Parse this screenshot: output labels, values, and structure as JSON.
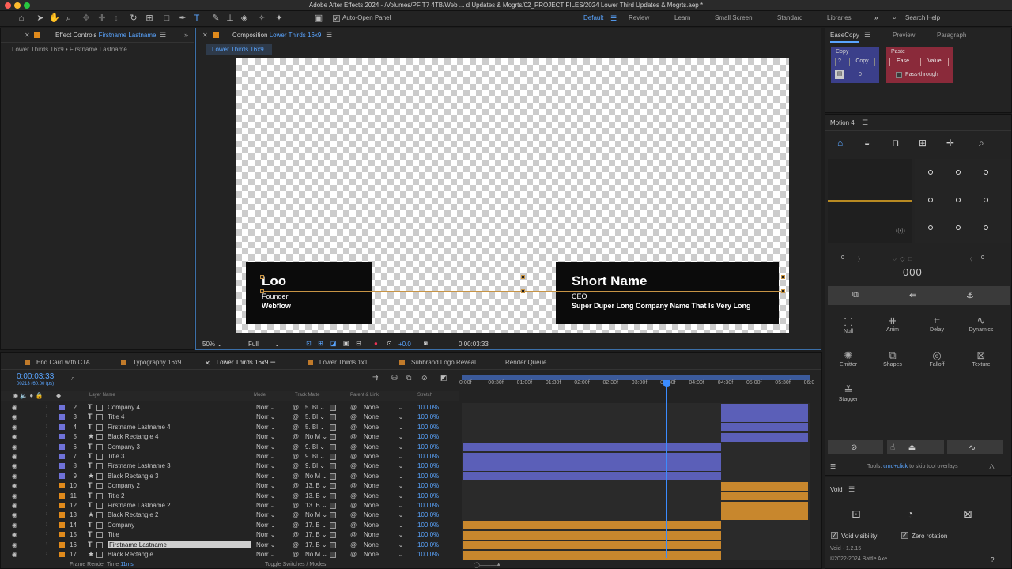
{
  "window": {
    "title": "Adobe After Effects 2024 - /Volumes/PF T7 4TB/Web ... d Updates & Mogrts/02_PROJECT FILES/2024 Lower Third Updates & Mogrts.aep *"
  },
  "toolbar": {
    "auto_open_label": "Auto-Open Panel",
    "search_label": "Search Help",
    "workspaces": [
      "Default",
      "Review",
      "Learn",
      "Small Screen",
      "Standard",
      "Libraries"
    ]
  },
  "effect_controls": {
    "tab_label": "Effect Controls",
    "tab_layer": "Firstname Lastname",
    "breadcrumb": "Lower Thirds 16x9 • Firstname Lastname"
  },
  "composition": {
    "tab_label": "Composition",
    "tab_comp": "Lower Thirds 16x9",
    "subtab": "Lower Thirds 16x9",
    "zoom": "50%",
    "quality": "Full",
    "exposure": "+0.0",
    "timecode": "0:00:03:33",
    "left_card": {
      "name": "Loo",
      "role": "Founder",
      "company": "Webflow"
    },
    "right_card": {
      "name": "Short Name",
      "role": "CEO",
      "company": "Super Duper Long Company Name That Is Very Long"
    }
  },
  "easecopy": {
    "tabs": [
      "EaseCopy",
      "Preview",
      "Paragraph"
    ],
    "copy_label": "Copy",
    "copy_button": "Copy",
    "q_button": "?",
    "count": "0",
    "paste_label": "Paste",
    "ease_button": "Ease",
    "value_button": "Value",
    "passthrough": "Pass-through"
  },
  "motion": {
    "title": "Motion 4",
    "left_value": "0",
    "right_value": "0",
    "center_value": "000",
    "tools": [
      {
        "label": "Null",
        "icon": "null-icon"
      },
      {
        "label": "Anim",
        "icon": "anim-icon"
      },
      {
        "label": "Delay",
        "icon": "delay-icon"
      },
      {
        "label": "Dynamics",
        "icon": "dynamics-icon"
      },
      {
        "label": "Emitter",
        "icon": "emitter-icon"
      },
      {
        "label": "Shapes",
        "icon": "shapes-icon"
      },
      {
        "label": "Falloff",
        "icon": "falloff-icon"
      },
      {
        "label": "Texture",
        "icon": "texture-icon"
      },
      {
        "label": "Stagger",
        "icon": "stagger-icon"
      }
    ],
    "tip_prefix": "Tools: ",
    "tip_key": "cmd+click",
    "tip_suffix": " to skip tool overlays"
  },
  "void": {
    "title": "Void",
    "void_visibility": "Void visibility",
    "zero_rotation": "Zero rotation",
    "version": "Void - 1.2.15",
    "copyright": "©2022-2024 Battle Axe"
  },
  "timeline": {
    "tabs": [
      {
        "label": "End Card with CTA",
        "color": "#c07a2a"
      },
      {
        "label": "Typography 16x9",
        "color": "#c07a2a"
      },
      {
        "label": "Lower Thirds 16x9",
        "color": "#c07a2a"
      },
      {
        "label": "Lower Thirds 1x1",
        "color": "#c07a2a"
      },
      {
        "label": "Subbrand Logo Reveal",
        "color": "#c07a2a"
      },
      {
        "label": "Render Queue",
        "color": ""
      }
    ],
    "timecode": "0:00:03:33",
    "fps": "00213 (60.00 fps)",
    "search_placeholder": "",
    "headers": {
      "layer_name": "Layer Name",
      "mode": "Mode",
      "track_matte": "Track Matte",
      "parent": "Parent & Link",
      "stretch": "Stretch"
    },
    "ruler": [
      "0:00f",
      "00:30f",
      "01:00f",
      "01:30f",
      "02:00f",
      "02:30f",
      "03:00f",
      "03:30f",
      "04:00f",
      "04:30f",
      "05:00f",
      "05:30f",
      "06:0"
    ],
    "footer_left": "Frame Render Time",
    "footer_ms": "11ms",
    "footer_toggle": "Toggle Switches / Modes",
    "layers": [
      {
        "num": "2",
        "type": "T",
        "name": "Company 4",
        "mode": "Norr",
        "matte": "5. Bl",
        "parent": "None",
        "stretch": "100.0%",
        "color": "#6f72d8",
        "bar": "purple",
        "start": 0.75
      },
      {
        "num": "3",
        "type": "T",
        "name": "Title 4",
        "mode": "Norr",
        "matte": "5. Bl",
        "parent": "None",
        "stretch": "100.0%",
        "color": "#6f72d8",
        "bar": "purple",
        "start": 0.75
      },
      {
        "num": "4",
        "type": "T",
        "name": "Firstname Lastname 4",
        "mode": "Norr",
        "matte": "5. Bl",
        "parent": "None",
        "stretch": "100.0%",
        "color": "#6f72d8",
        "bar": "purple",
        "start": 0.75
      },
      {
        "num": "5",
        "type": "★",
        "name": "Black Rectangle 4",
        "mode": "Norr",
        "matte": "No M",
        "parent": "None",
        "stretch": "100.0%",
        "color": "#6f72d8",
        "bar": "purple",
        "start": 0.75
      },
      {
        "num": "6",
        "type": "T",
        "name": "Company 3",
        "mode": "Norr",
        "matte": "9. Bl",
        "parent": "None",
        "stretch": "100.0%",
        "color": "#6f72d8",
        "bar": "purple",
        "start": 0
      },
      {
        "num": "7",
        "type": "T",
        "name": "Title 3",
        "mode": "Norr",
        "matte": "9. Bl",
        "parent": "None",
        "stretch": "100.0%",
        "color": "#6f72d8",
        "bar": "purple",
        "start": 0
      },
      {
        "num": "8",
        "type": "T",
        "name": "Firstname Lastname 3",
        "mode": "Norr",
        "matte": "9. Bl",
        "parent": "None",
        "stretch": "100.0%",
        "color": "#6f72d8",
        "bar": "purple",
        "start": 0
      },
      {
        "num": "9",
        "type": "★",
        "name": "Black Rectangle 3",
        "mode": "Norr",
        "matte": "No M",
        "parent": "None",
        "stretch": "100.0%",
        "color": "#6f72d8",
        "bar": "purple",
        "start": 0
      },
      {
        "num": "10",
        "type": "T",
        "name": "Company 2",
        "mode": "Norr",
        "matte": "13. B",
        "parent": "None",
        "stretch": "100.0%",
        "color": "#e08a1c",
        "bar": "orange",
        "start": 0.75
      },
      {
        "num": "11",
        "type": "T",
        "name": "Title 2",
        "mode": "Norr",
        "matte": "13. B",
        "parent": "None",
        "stretch": "100.0%",
        "color": "#e08a1c",
        "bar": "orange",
        "start": 0.75
      },
      {
        "num": "12",
        "type": "T",
        "name": "Firstname Lastname 2",
        "mode": "Norr",
        "matte": "13. B",
        "parent": "None",
        "stretch": "100.0%",
        "color": "#e08a1c",
        "bar": "orange",
        "start": 0.75
      },
      {
        "num": "13",
        "type": "★",
        "name": "Black Rectangle 2",
        "mode": "Norr",
        "matte": "No M",
        "parent": "None",
        "stretch": "100.0%",
        "color": "#e08a1c",
        "bar": "orange",
        "start": 0.75
      },
      {
        "num": "14",
        "type": "T",
        "name": "Company",
        "mode": "Norr",
        "matte": "17. B",
        "parent": "None",
        "stretch": "100.0%",
        "color": "#e08a1c",
        "bar": "orange",
        "start": 0
      },
      {
        "num": "15",
        "type": "T",
        "name": "Title",
        "mode": "Norr",
        "matte": "17. B",
        "parent": "None",
        "stretch": "100.0%",
        "color": "#e08a1c",
        "bar": "orange",
        "start": 0
      },
      {
        "num": "16",
        "type": "T",
        "name": "Firstname Lastname",
        "mode": "Norr",
        "matte": "17. B",
        "parent": "None",
        "stretch": "100.0%",
        "color": "#e08a1c",
        "bar": "orange",
        "start": 0,
        "selected": true
      },
      {
        "num": "17",
        "type": "★",
        "name": "Black Rectangle",
        "mode": "Norr",
        "matte": "No M",
        "parent": "None",
        "stretch": "100.0%",
        "color": "#e08a1c",
        "bar": "orange",
        "start": 0
      }
    ]
  },
  "colors": {
    "accent": "#5aa5ff",
    "purple": "#6f72d8",
    "orange": "#e08a1c",
    "panel_bg": "#232323"
  }
}
